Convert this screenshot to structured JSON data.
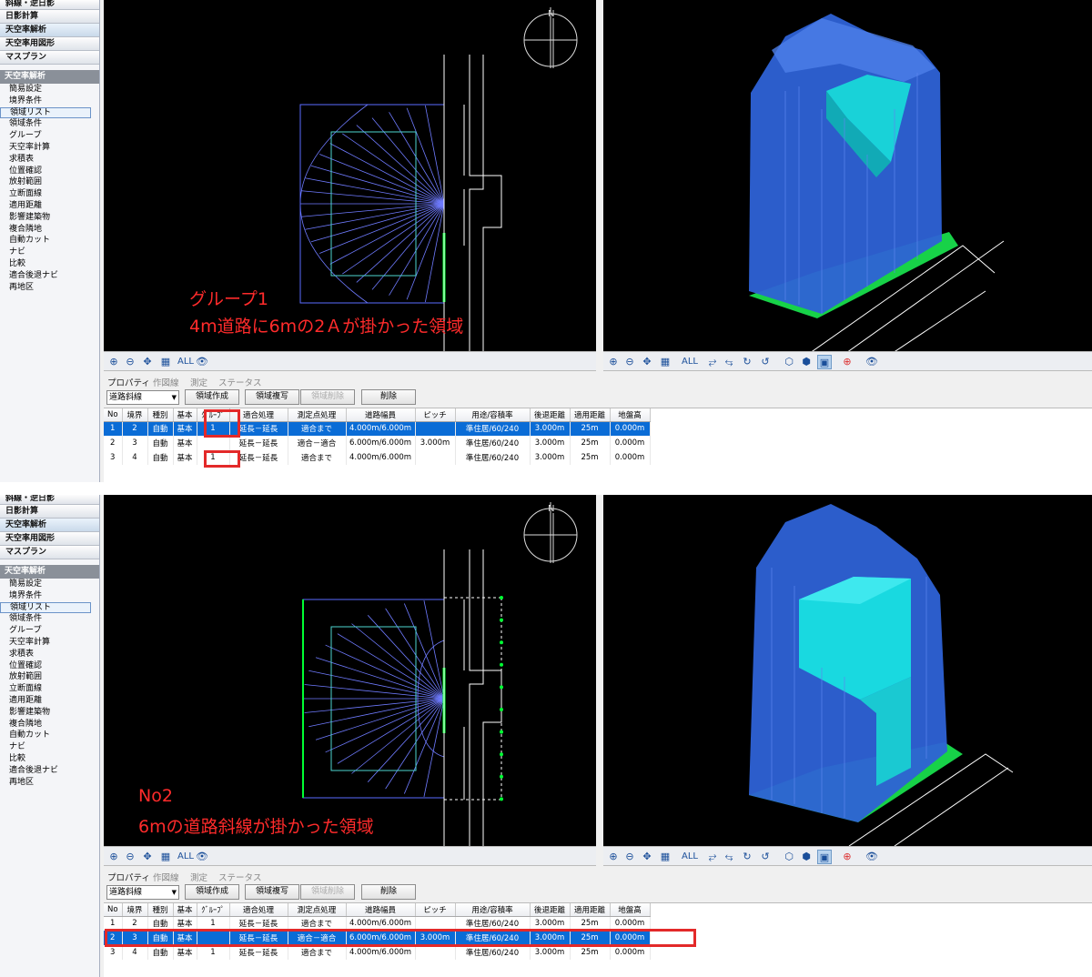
{
  "app": {
    "menu": [
      "斜線・逆日影",
      "日影計算",
      "天空率解析",
      "天空率用図形",
      "マスプラン"
    ],
    "section_header": "天空率解析",
    "submenu": [
      "簡易設定",
      "境界条件",
      "領域リスト",
      "領域条件",
      "グループ",
      "天空率計算",
      "求積表",
      "位置確認",
      "放射範囲",
      "立断面線",
      "適用距離",
      "影響建築物",
      "複合隣地",
      "自動カット",
      "ナビ",
      "比較",
      "適合後退ナビ",
      "再地区"
    ],
    "selected_submenu": "領域リスト"
  },
  "toolbar": {
    "left": {
      "zoom_in": "⊕",
      "zoom_out": "⊖",
      "pan": "✥",
      "fit": "▦",
      "all": "ALL",
      "view": "👁"
    },
    "right": {
      "zoom_in": "⊕",
      "zoom_out": "⊖",
      "pan": "✥",
      "fit": "▦",
      "all": "ALL",
      "rot1": "⥂",
      "rot2": "⥃",
      "rot3": "↻",
      "rot4": "↺",
      "box1": "⬡",
      "box2": "⬢",
      "box3": "▣",
      "axis": "⊕",
      "view": "👁"
    }
  },
  "tabs": [
    "プロパティ",
    "作図線",
    "測定",
    "ステータス"
  ],
  "controls": {
    "dropdown": "道路斜線",
    "buttons": [
      "領域作成",
      "領域複写",
      "領域削除",
      "削除"
    ]
  },
  "columns": [
    "No",
    "境界",
    "種別",
    "基本",
    "ｸﾞﾙｰﾌﾟ",
    "適合処理",
    "測定点処理",
    "道路幅員",
    "ピッチ",
    "用途/容積率",
    "後退距離",
    "適用距離",
    "地盤高"
  ],
  "panels": [
    {
      "annotation": [
        "グループ1",
        "4m道路に6mの2Ａが掛かった領域"
      ],
      "rows": [
        [
          "1",
          "2",
          "自動",
          "基本",
          "1",
          "延長－延長",
          "適合まで",
          "4.000m/6.000m",
          "",
          "準住居/60/240",
          "3.000m",
          "25m",
          "0.000m"
        ],
        [
          "2",
          "3",
          "自動",
          "基本",
          "",
          "延長－延長",
          "適合－適合",
          "6.000m/6.000m",
          "3.000m",
          "準住居/60/240",
          "3.000m",
          "25m",
          "0.000m"
        ],
        [
          "3",
          "4",
          "自動",
          "基本",
          "1",
          "延長－延長",
          "適合まで",
          "4.000m/6.000m",
          "",
          "準住居/60/240",
          "3.000m",
          "25m",
          "0.000m"
        ]
      ],
      "selected_row": 0
    },
    {
      "annotation": [
        "No2",
        "6mの道路斜線が掛かった領域"
      ],
      "rows": [
        [
          "1",
          "2",
          "自動",
          "基本",
          "1",
          "延長－延長",
          "適合まで",
          "4.000m/6.000m",
          "",
          "準住居/60/240",
          "3.000m",
          "25m",
          "0.000m"
        ],
        [
          "2",
          "3",
          "自動",
          "基本",
          "",
          "延長－延長",
          "適合－適合",
          "6.000m/6.000m",
          "3.000m",
          "準住居/60/240",
          "3.000m",
          "25m",
          "0.000m"
        ],
        [
          "3",
          "4",
          "自動",
          "基本",
          "1",
          "延長－延長",
          "適合まで",
          "4.000m/6.000m",
          "",
          "準住居/60/240",
          "3.000m",
          "25m",
          "0.000m"
        ]
      ],
      "selected_row": 1
    }
  ],
  "compass": "N"
}
